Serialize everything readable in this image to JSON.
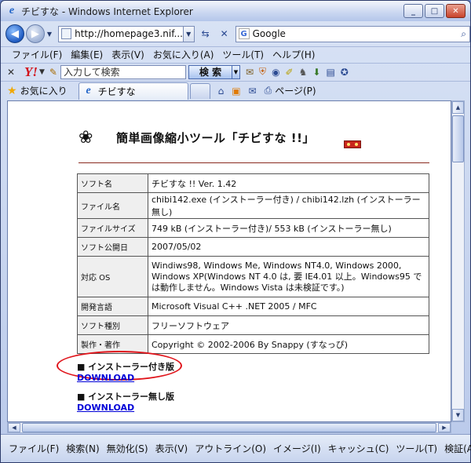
{
  "window": {
    "title": "チビすな - Windows Internet Explorer",
    "minimize": "_",
    "maximize": "□",
    "close": "✕"
  },
  "address": {
    "url": "http://homepage3.nif...",
    "search_engine": "Google"
  },
  "menu": [
    "ファイル(F)",
    "編集(E)",
    "表示(V)",
    "お気に入り(A)",
    "ツール(T)",
    "ヘルプ(H)"
  ],
  "yahoo_toolbar": {
    "logo": "Y!",
    "input_placeholder": "入力して検索",
    "search_button": "検 索"
  },
  "tabs": {
    "favorites_label": "お気に入り",
    "active_tab_label": "チビすな",
    "page_menu": "ページ(P)"
  },
  "page": {
    "title": "簡単画像縮小ツール「チビすな !!」",
    "table": [
      {
        "label": "ソフト名",
        "value": "チビすな !! Ver. 1.42"
      },
      {
        "label": "ファイル名",
        "value": "chibi142.exe (インストーラー付き) / chibi142.lzh (インストーラー無し)"
      },
      {
        "label": "ファイルサイズ",
        "value": "749 kB (インストーラー付き)/ 553 kB (インストーラー無し)"
      },
      {
        "label": "ソフト公開日",
        "value": "2007/05/02"
      },
      {
        "label": "対応 OS",
        "value": "Windiws98, Windows Me, Windows NT4.0, Windows 2000, Windows XP(Windows NT 4.0 は, 要 IE4.01 以上。Windows95 では動作しません。Windows Vista は未検証です。)"
      },
      {
        "label": "開発言語",
        "value": "Microsoft Visual C++ .NET 2005 / MFC"
      },
      {
        "label": "ソフト種別",
        "value": "フリーソフトウェア"
      },
      {
        "label": "製作・著作",
        "value": "Copyright © 2002-2006 By Snappy (すなっぴ)"
      }
    ],
    "downloads": [
      {
        "title": "■ インストーラー付き版",
        "link": "DOWNLOAD"
      },
      {
        "title": "■ インストーラー無し版",
        "link": "DOWNLOAD"
      }
    ]
  },
  "bottom_toolbar": [
    "ファイル(F)",
    "検索(N)",
    "無効化(S)",
    "表示(V)",
    "アウトライン(O)",
    "イメージ(I)",
    "キャッシュ(C)",
    "ツール(T)",
    "検証(A)"
  ],
  "colors": {
    "accent_ring": "#e0141b",
    "link": "#0000d8",
    "rule": "#8a2a1f"
  }
}
